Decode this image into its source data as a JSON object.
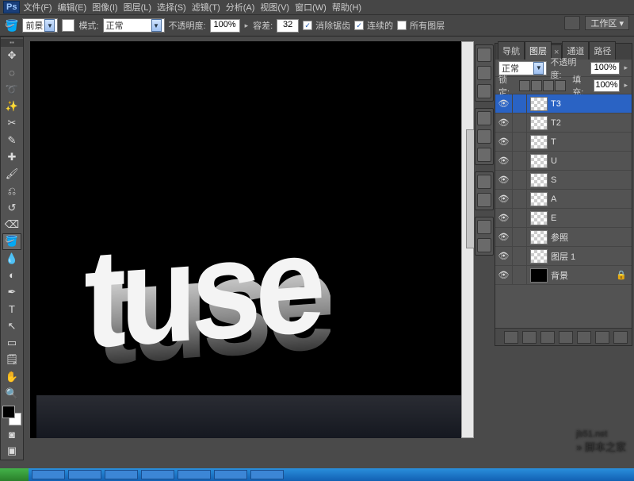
{
  "menu": [
    "文件(F)",
    "编辑(E)",
    "图像(I)",
    "图层(L)",
    "选择(S)",
    "滤镜(T)",
    "分析(A)",
    "视图(V)",
    "窗口(W)",
    "帮助(H)"
  ],
  "options": {
    "fill_label": "前景",
    "fill_arrow": "▾",
    "mode_label": "模式:",
    "mode_value": "正常",
    "opacity_label": "不透明度:",
    "opacity_value": "100%",
    "tolerance_label": "容差:",
    "tolerance_value": "32",
    "antialias": "消除锯齿",
    "contiguous": "连续的",
    "all_layers": "所有图层",
    "workspace_label": "工作区 ▾"
  },
  "canvas_text": "tuse",
  "panel": {
    "tabs": [
      "导航",
      "图层",
      "通道",
      "路径"
    ],
    "blend_value": "正常",
    "opacity_label": "不透明度:",
    "opacity_value": "100%",
    "lock_label": "锁定:",
    "fill_label": "填充:",
    "fill_value": "100%"
  },
  "layers": [
    {
      "name": "T3",
      "sel": true,
      "thumb": "checker"
    },
    {
      "name": "T2",
      "thumb": "checker"
    },
    {
      "name": "T",
      "thumb": "checker"
    },
    {
      "name": "U",
      "thumb": "checker"
    },
    {
      "name": "S",
      "thumb": "checker"
    },
    {
      "name": "A",
      "thumb": "checker"
    },
    {
      "name": "E",
      "thumb": "checker"
    },
    {
      "name": "参照",
      "thumb": "checker"
    },
    {
      "name": "图层 1",
      "thumb": "checker"
    },
    {
      "name": "背景",
      "thumb": "black",
      "locked": true
    }
  ],
  "watermark": {
    "url": "jb51.net",
    "cn": "»  脚本之家"
  },
  "checks": {
    "antialias": true,
    "contiguous": true,
    "all_layers": false
  }
}
